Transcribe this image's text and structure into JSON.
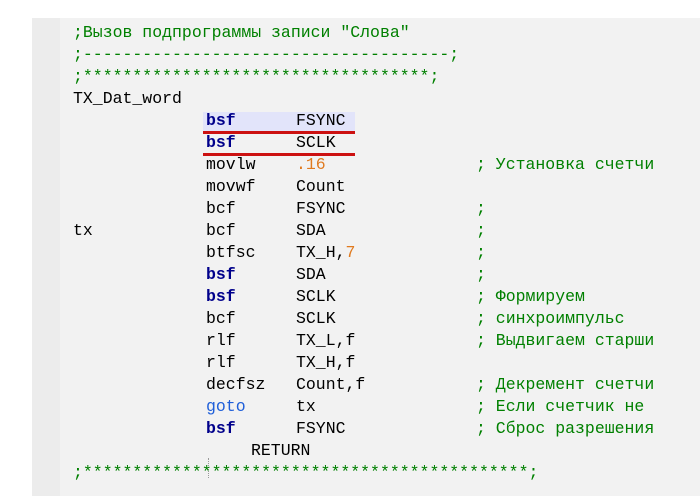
{
  "header_comments": [
    ";Вызов подпрограммы записи \"Слова\"",
    ";-------------------------------------;",
    ";***********************************;"
  ],
  "label_main": "TX_Dat_word",
  "rows": [
    {
      "label": "",
      "op": "bsf",
      "op_style": "bsf",
      "arg": "FSYNC",
      "arg_num": "",
      "comment": ""
    },
    {
      "label": "",
      "op": "bsf",
      "op_style": "bsf",
      "arg": "SCLK",
      "arg_num": "",
      "comment": ""
    },
    {
      "label": "",
      "op": "movlw",
      "op_style": "",
      "arg": "",
      "arg_num": ".16",
      "comment": "; Установка счетчи"
    },
    {
      "label": "",
      "op": "movwf",
      "op_style": "",
      "arg": "Count",
      "arg_num": "",
      "comment": ""
    },
    {
      "label": "",
      "op": "bcf",
      "op_style": "",
      "arg": "FSYNC",
      "arg_num": "",
      "comment": ";"
    },
    {
      "label": "tx",
      "op": "bcf",
      "op_style": "",
      "arg": "SDA",
      "arg_num": "",
      "comment": ";"
    },
    {
      "label": "",
      "op": "btfsc",
      "op_style": "",
      "arg": "TX_H,",
      "arg_num": "7",
      "comment": ";"
    },
    {
      "label": "",
      "op": "bsf",
      "op_style": "bsf",
      "arg": "SDA",
      "arg_num": "",
      "comment": ";"
    },
    {
      "label": "",
      "op": "bsf",
      "op_style": "bsf",
      "arg": "SCLK",
      "arg_num": "",
      "comment": "; Формируем"
    },
    {
      "label": "",
      "op": "bcf",
      "op_style": "",
      "arg": "SCLK",
      "arg_num": "",
      "comment": "; синхроимпульс"
    },
    {
      "label": "",
      "op": "rlf",
      "op_style": "",
      "arg": "TX_L,f",
      "arg_num": "",
      "comment": "; Выдвигаем старши"
    },
    {
      "label": "",
      "op": "rlf",
      "op_style": "",
      "arg": "TX_H,f",
      "arg_num": "",
      "comment": ""
    },
    {
      "label": "",
      "op": "decfsz",
      "op_style": "",
      "arg": "Count,f",
      "arg_num": "",
      "comment": "; Декремент счетчи"
    },
    {
      "label": "",
      "op": "goto",
      "op_style": "goto",
      "arg": "tx",
      "arg_num": "",
      "comment": "; Если счетчик не"
    },
    {
      "label": "",
      "op": "bsf",
      "op_style": "bsf",
      "arg": "FSYNC",
      "arg_num": "",
      "comment": "; Сброс разрешения"
    }
  ],
  "return_text": "RETURN",
  "footer_comment": ";*********************************************;",
  "colors": {
    "comment": "#008000",
    "keyword_bsf": "#00008b",
    "keyword_goto": "#1f5fd9",
    "number": "#e07a1f",
    "highlight": "#e2e4fa",
    "underline": "#cc1111"
  }
}
